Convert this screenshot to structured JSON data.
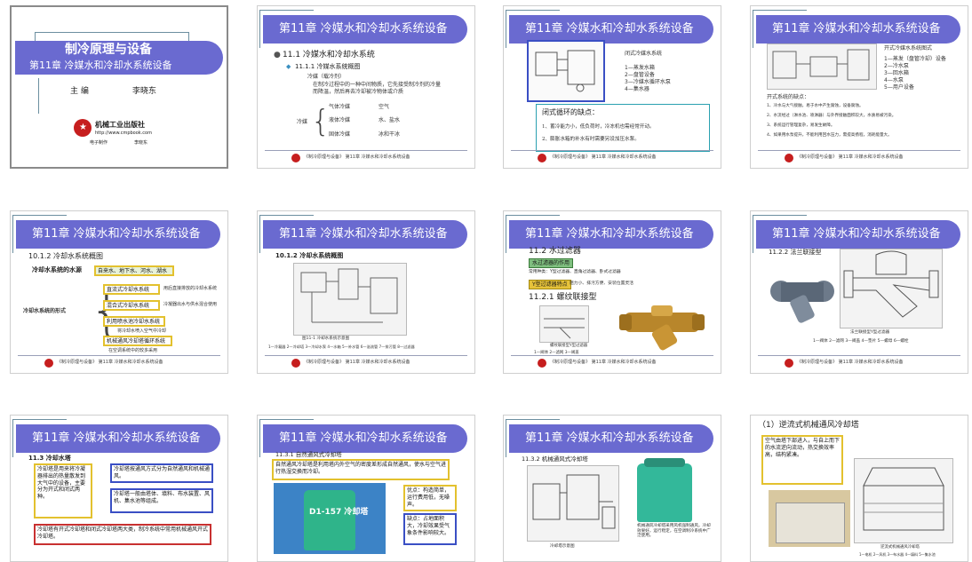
{
  "header": "第11章  冷媒水和冷却水系统设备",
  "footer": "《制冷原理与设备》  第11章  冷媒水和冷却水系统设备",
  "cover": {
    "title": "制冷原理与设备",
    "subtitle": "第11章  冷媒水和冷却水系统设备",
    "author_role": "主  编",
    "author": "李晓东",
    "publisher": "机械工业出版社",
    "url": "http://www.cmpbook.com",
    "footer_left": "电子制作",
    "footer_right": "李晓东"
  },
  "s2": {
    "h1": "11.1 冷媒水和冷却水系统",
    "h2": "11.1.1 冷媒水系统概图",
    "b1": "冷媒（载冷剂）",
    "b2a": "在制冷过程中的一种中间物质，它先接受制冷剂的冷量",
    "b2b": "而降温，然后再去冷却被冷物体或介质",
    "left": "冷媒",
    "rows": [
      [
        "气体冷媒",
        "空气"
      ],
      [
        "液体冷媒",
        "水、盐水"
      ],
      [
        "固体冷媒",
        "冰和干冰"
      ]
    ]
  },
  "s3": {
    "caption": "闭式冷媒水系统",
    "legend": [
      "1—蒸发水箱",
      "2—盘管设备",
      "3—冷媒水循环水泵",
      "4—集水器"
    ],
    "title": "闭式循环的缺点：",
    "l1": "1、蓄冷能力小，低负荷时，冷冻机也需经常开动。",
    "l2": "2、膨胀水箱的补水有时需要另设加压水泵。"
  },
  "s4": {
    "caption": "开式冷媒水系统图式",
    "legend": [
      "1—蒸发（盘管冷却）设备",
      "2—冷水泵",
      "3—回水箱",
      "4—水泵",
      "5—用户设备"
    ],
    "title": "开式系统的缺点：",
    "lines": [
      "1、冷水与大气接触，易于水中产生腐蚀，设备腐蚀。",
      "2、水流经过（淋水池、喷淋器）与外界接触面积较大，水质易被污染。",
      "3、系统运行管理复杂，易发生故障。",
      "4、如果用水泵提升，不能利用回水压力，需提高扬程，消耗能量大。"
    ]
  },
  "s5": {
    "h1": "10.1.2 冷却水系统概图",
    "source": "冷却水系统的水源",
    "source_items": "自来水、地下水、河水、湖水",
    "left": "冷却水系统的形式",
    "items": [
      "直流式冷却水系统",
      "混合式冷却水系统",
      "利用喷水池冷却水系统",
      "机械通风冷却塔循环系统"
    ],
    "notes": [
      "用后直接排放的冷却水系统",
      "冷凝器出水与供水混合使用",
      "将冷却水喷入空气中冷却",
      "在空调系统中的较多采用"
    ]
  },
  "s6": {
    "h1": "10.1.2 冷却水系统概图",
    "caption": "图11-1  冷却水系统示意图",
    "legend": "1—冷凝器  2—冷却塔  3—冷却水泵  4—水箱  5—补水管  6—溢流管  7—排污管  8—过滤器"
  },
  "s7": {
    "h1": "11.2 水过滤器",
    "tag1": "水过滤器的作用",
    "line1": "常用种类：Y型过滤器、直角过滤器、卧式过滤器",
    "tag2": "Y型过滤器特点",
    "line2": "阻力小、排污方便、安装位置灵活",
    "h2": "11.2.1 螺纹联接型",
    "caption": "螺纹联接型Y型过滤器",
    "legend": "1—阀体  2—滤网  3—阀盖"
  },
  "s8": {
    "h1": "11.2.2 法兰联接型",
    "caption": "法兰联接型Y型过滤器",
    "legend": "1—阀体  2—滤网  3—阀盖  4—垫片  5—螺母  6—螺栓"
  },
  "s9": {
    "h1": "11.3 冷却水塔",
    "box1": "冷却塔是用来将冷凝器排出的热量散发到大气中的设备，主要分为开式和闭式两种。",
    "box2": "冷却塔按通风方式分为自然通风和机械通风。",
    "box3": "冷却塔一般由塔体、填料、布水装置、风机、集水池等组成。",
    "box4": "冷却塔有开式冷却塔和闭式冷却塔两大类，制冷系统中常用机械通风开式冷却塔。"
  },
  "s10": {
    "h1": "11.3.1 自然通风式冷却塔",
    "top": "自然通风冷却塔是利用塔内外空气的密度差形成自然通风，使水与空气进行热湿交换而冷却。",
    "photo_text": "D1-157 冷却塔",
    "r1": "优点：构造简单，运行费用低，无噪声。",
    "r2": "缺点：占地面积大，冷却效果受气象条件影响较大。"
  },
  "s11": {
    "h1": "11.3.2 机械通风式冷却塔",
    "cap_left": "冷却塔示意图",
    "text": "机械通风冷却塔采用风机强制通风，冷却效果好，运行稳定，在空调制冷系统中广泛使用。"
  },
  "s12": {
    "h1": "（1）逆流式机械通风冷却塔",
    "box": "空气由塔下部进入，与自上而下的水流逆向流动，热交换效率高，结构紧凑。",
    "caption": "逆流式机械通风冷却塔",
    "legend": "1—电机  2—风机  3—布水器  4—填料  5—集水池"
  }
}
